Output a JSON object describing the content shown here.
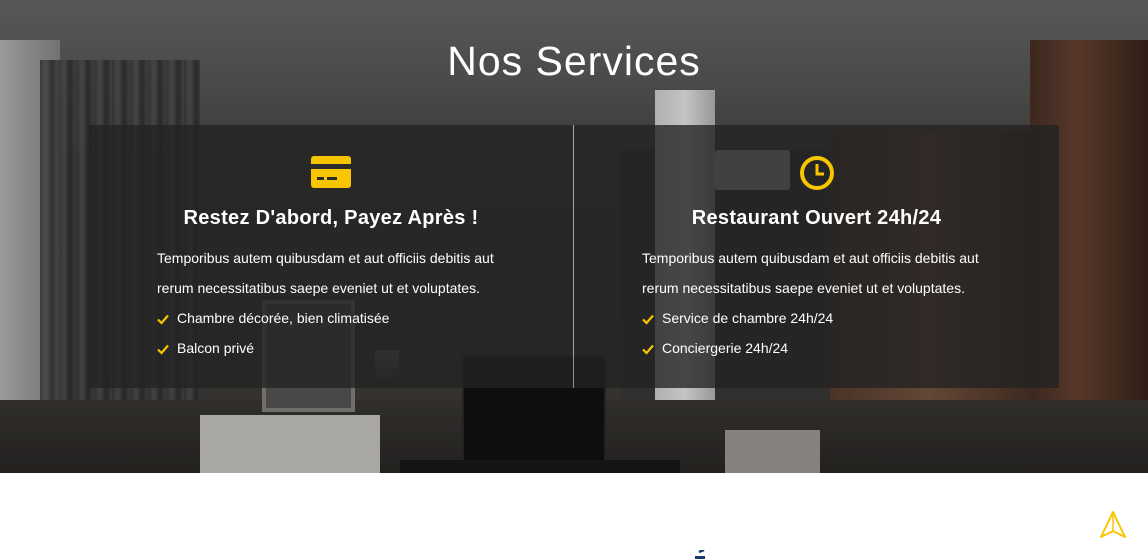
{
  "section": {
    "title": "Nos Services"
  },
  "services": [
    {
      "icon": "credit-card-icon",
      "title": "Restez D'abord, Payez Après !",
      "description": "Temporibus autem quibusdam et aut officiis debitis aut rerum necessitatibus saepe eveniet ut et voluptates.",
      "features": [
        "Chambre décorée, bien climatisée",
        "Balcon privé"
      ]
    },
    {
      "icon": "clock-icon",
      "title": "Restaurant Ouvert 24h/24",
      "description": "Temporibus autem quibusdam et aut officiis debitis aut rerum necessitatibus saepe eveniet ut et voluptates.",
      "features": [
        "Service de chambre 24h/24",
        "Conciergerie 24h/24"
      ]
    }
  ],
  "ui": {
    "scroll_top_icon": "navigation-arrow-icon"
  },
  "colors": {
    "accent": "#f7c600",
    "panel": "rgba(34,34,34,0.78)",
    "heading_partial": "#1a3a6b"
  }
}
